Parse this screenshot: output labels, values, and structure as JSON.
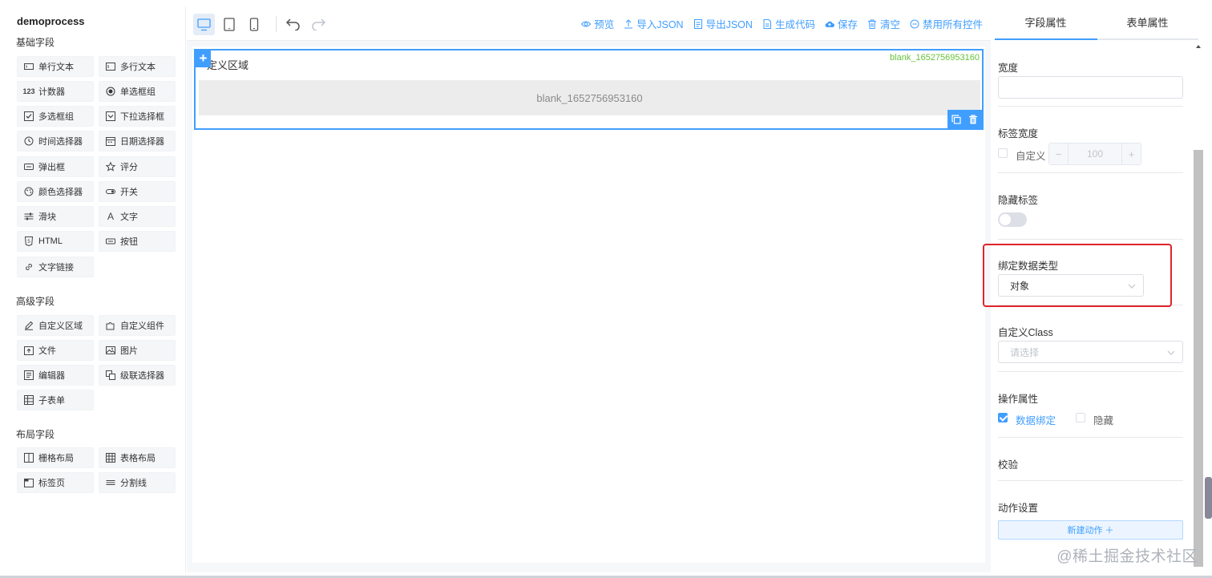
{
  "app": {
    "title": "demoprocess"
  },
  "left": {
    "groups": [
      {
        "title": "基础字段",
        "items": [
          {
            "label": "单行文本",
            "icon": "single-line-text-icon"
          },
          {
            "label": "多行文本",
            "icon": "multi-line-text-icon"
          },
          {
            "label": "计数器",
            "icon": "counter-icon"
          },
          {
            "label": "单选框组",
            "icon": "radio-group-icon"
          },
          {
            "label": "多选框组",
            "icon": "checkbox-group-icon"
          },
          {
            "label": "下拉选择框",
            "icon": "select-icon"
          },
          {
            "label": "时间选择器",
            "icon": "clock-icon"
          },
          {
            "label": "日期选择器",
            "icon": "calendar-icon"
          },
          {
            "label": "弹出框",
            "icon": "dialog-icon"
          },
          {
            "label": "评分",
            "icon": "star-icon"
          },
          {
            "label": "颜色选择器",
            "icon": "palette-icon"
          },
          {
            "label": "开关",
            "icon": "switch-icon"
          },
          {
            "label": "滑块",
            "icon": "slider-icon"
          },
          {
            "label": "文字",
            "icon": "text-icon"
          },
          {
            "label": "HTML",
            "icon": "html-icon"
          },
          {
            "label": "按钮",
            "icon": "button-icon"
          },
          {
            "label": "文字链接",
            "icon": "link-icon"
          }
        ]
      },
      {
        "title": "高级字段",
        "items": [
          {
            "label": "自定义区域",
            "icon": "pen-icon"
          },
          {
            "label": "自定义组件",
            "icon": "puzzle-icon"
          },
          {
            "label": "文件",
            "icon": "file-icon"
          },
          {
            "label": "图片",
            "icon": "image-icon"
          },
          {
            "label": "编辑器",
            "icon": "editor-icon"
          },
          {
            "label": "级联选择器",
            "icon": "cascader-icon"
          },
          {
            "label": "子表单",
            "icon": "table-icon"
          }
        ]
      },
      {
        "title": "布局字段",
        "items": [
          {
            "label": "栅格布局",
            "icon": "grid-icon"
          },
          {
            "label": "表格布局",
            "icon": "table-layout-icon"
          },
          {
            "label": "标签页",
            "icon": "tabs-icon"
          },
          {
            "label": "分割线",
            "icon": "divider-icon"
          }
        ]
      }
    ]
  },
  "toolbar": {
    "actions": [
      {
        "label": "预览",
        "icon": "eye-icon"
      },
      {
        "label": "导入JSON",
        "icon": "upload-icon"
      },
      {
        "label": "导出JSON",
        "icon": "export-doc-icon"
      },
      {
        "label": "生成代码",
        "icon": "code-doc-icon"
      },
      {
        "label": "保存",
        "icon": "cloud-save-icon"
      },
      {
        "label": "清空",
        "icon": "trash-icon"
      },
      {
        "label": "禁用所有控件",
        "icon": "disable-icon"
      }
    ]
  },
  "canvas": {
    "widget": {
      "label": "定义区域",
      "id": "blank_1652756953160",
      "content": "blank_1652756953160"
    }
  },
  "right": {
    "tabs": [
      "字段属性",
      "表单属性"
    ],
    "width_label": "宽度",
    "width_value": "",
    "label_width": {
      "title": "标签宽度",
      "custom_label": "自定义",
      "value": "100",
      "minus": "−",
      "plus": "+"
    },
    "hide_label": {
      "title": "隐藏标签",
      "on": false
    },
    "bind_type": {
      "title": "绑定数据类型",
      "value": "对象"
    },
    "custom_class": {
      "title": "自定义Class",
      "placeholder": "请选择"
    },
    "operation": {
      "title": "操作属性",
      "data_bind": "数据绑定",
      "data_bind_checked": true,
      "hidden": "隐藏",
      "hidden_checked": false
    },
    "validate": {
      "title": "校验"
    },
    "actions": {
      "title": "动作设置",
      "new_label": "新建动作 ＋"
    }
  },
  "watermark": "@稀土掘金技术社区",
  "colors": {
    "accent": "#409eff",
    "highlight": "#e0232b",
    "id_green": "#67c23a"
  }
}
